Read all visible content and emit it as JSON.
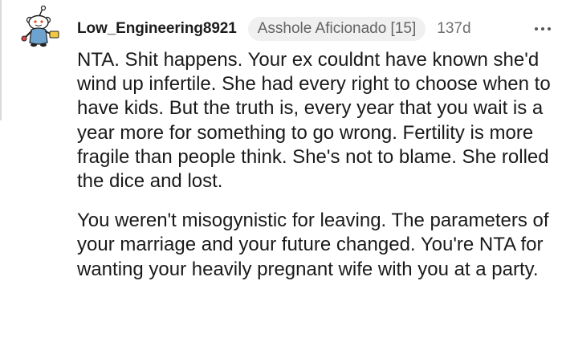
{
  "comment": {
    "username": "Low_Engineering8921",
    "flair": "Asshole Aficionado [15]",
    "age": "137d",
    "more_icon": "more-horizontal-icon",
    "avatar_icon": "snoo-avatar-icon",
    "paragraphs": [
      "NTA. Shit happens. Your ex couldnt have known she'd wind up infertile. She had every right to choose when to have kids. But the truth is, every year that you wait is a year more for something to go wrong. Fertility is more fragile than people think. She's not to blame. She rolled the dice and lost.",
      "You weren't misogynistic for leaving. The parameters of your marriage and your future changed. You're NTA for wanting your heavily pregnant wife with you at a party."
    ]
  }
}
